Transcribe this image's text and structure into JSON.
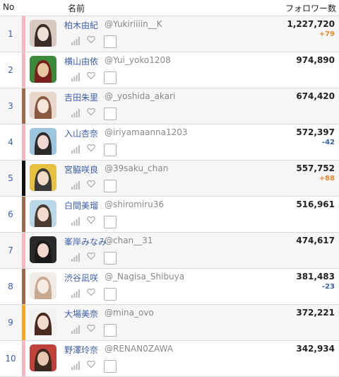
{
  "header": {
    "no": "No",
    "name": "名前",
    "followers": "フォロワー数"
  },
  "rows": [
    {
      "rank": "1",
      "name": "柏木由紀",
      "handle": "@Yukiriiiin__K",
      "followers": "1,227,720",
      "delta": "+79",
      "delta_dir": "up",
      "bar_color": "#f4b6c2",
      "avatar_colors": [
        "#d8c9c0",
        "#3b2c28",
        "#f0e0d6"
      ]
    },
    {
      "rank": "2",
      "name": "横山由依",
      "handle": "@Yui_yoko1208",
      "followers": "974,890",
      "delta": "",
      "delta_dir": "",
      "bar_color": "#f4b6c2",
      "avatar_colors": [
        "#3a8a3a",
        "#7a1e1e",
        "#e8c8a0"
      ]
    },
    {
      "rank": "3",
      "name": "吉田朱里",
      "handle": "@_yoshida_akari",
      "followers": "674,420",
      "delta": "",
      "delta_dir": "",
      "bar_color": "#9b6a4a",
      "avatar_colors": [
        "#e8d8cc",
        "#8a5a40",
        "#f6e6dc"
      ]
    },
    {
      "rank": "4",
      "name": "入山杏奈",
      "handle": "@iriyamaanna1203",
      "followers": "572,397",
      "delta": "-42",
      "delta_dir": "down",
      "bar_color": "#f4b6c2",
      "avatar_colors": [
        "#9cc6e0",
        "#2a2a2a",
        "#f0d8d0"
      ]
    },
    {
      "rank": "5",
      "name": "宮脇咲良",
      "handle": "@39saku_chan",
      "followers": "557,752",
      "delta": "+88",
      "delta_dir": "up",
      "bar_color": "#111111",
      "avatar_colors": [
        "#e8c040",
        "#3a3a3a",
        "#f2dcc8"
      ]
    },
    {
      "rank": "6",
      "name": "白間美瑠",
      "handle": "@shiromiru36",
      "followers": "516,961",
      "delta": "",
      "delta_dir": "",
      "bar_color": "#9b6a4a",
      "avatar_colors": [
        "#b8d8e8",
        "#4a3a30",
        "#f2dcd0"
      ]
    },
    {
      "rank": "7",
      "name": "峯岸みなみ",
      "handle": "@chan__31",
      "followers": "474,617",
      "delta": "",
      "delta_dir": "",
      "bar_color": "#f4b6c2",
      "avatar_colors": [
        "#2a2a2a",
        "#1a1a1a",
        "#f0d8cc"
      ]
    },
    {
      "rank": "8",
      "name": "渋谷凪咲",
      "handle": "@_Nagisa_Shibuya",
      "followers": "381,483",
      "delta": "-23",
      "delta_dir": "down",
      "bar_color": "#9b6a4a",
      "avatar_colors": [
        "#f0ece8",
        "#c8a890",
        "#f6ece4"
      ]
    },
    {
      "rank": "9",
      "name": "大場美奈",
      "handle": "@mina_ovo",
      "followers": "372,221",
      "delta": "",
      "delta_dir": "",
      "bar_color": "#f5a623",
      "avatar_colors": [
        "#f2f2f2",
        "#4a2a20",
        "#f2dcd0"
      ]
    },
    {
      "rank": "10",
      "name": "野澤玲奈",
      "handle": "@RENAN0ZAWA",
      "followers": "342,934",
      "delta": "",
      "delta_dir": "",
      "bar_color": "#f4b6c2",
      "avatar_colors": [
        "#c0403a",
        "#3a2a20",
        "#e8c8b0"
      ]
    }
  ]
}
